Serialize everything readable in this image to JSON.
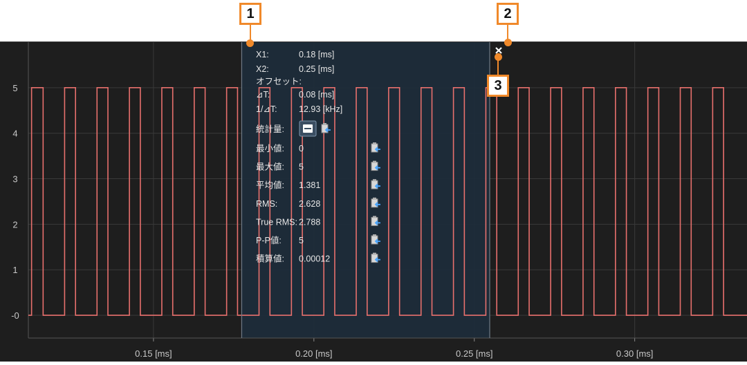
{
  "chart_data": {
    "type": "line",
    "xlabel": "",
    "ylabel": "",
    "xlim": [
      0.111,
      0.335
    ],
    "ylim": [
      -0.5,
      6.0
    ],
    "x_ticks": [
      {
        "value": 0.15,
        "label": "0.15 [ms]"
      },
      {
        "value": 0.2,
        "label": "0.20 [ms]"
      },
      {
        "value": 0.25,
        "label": "0.25 [ms]"
      },
      {
        "value": 0.3,
        "label": "0.30 [ms]"
      }
    ],
    "y_ticks": [
      {
        "value": 0,
        "label": "-0"
      },
      {
        "value": 1,
        "label": "1"
      },
      {
        "value": 2,
        "label": "2"
      },
      {
        "value": 3,
        "label": "3"
      },
      {
        "value": 4,
        "label": "4"
      },
      {
        "value": 5,
        "label": "5"
      }
    ],
    "grid": true,
    "series": [
      {
        "color": "#e8706d",
        "low": 0,
        "high": 5,
        "pulses": [
          [
            0.112,
            0.1156
          ],
          [
            0.1223,
            0.1257
          ],
          [
            0.1324,
            0.1358
          ],
          [
            0.1425,
            0.1459
          ],
          [
            0.1526,
            0.156
          ],
          [
            0.1627,
            0.1661
          ],
          [
            0.1728,
            0.1762
          ],
          [
            0.1829,
            0.1863
          ],
          [
            0.193,
            0.1964
          ],
          [
            0.2031,
            0.2065
          ],
          [
            0.2132,
            0.2166
          ],
          [
            0.2233,
            0.2267
          ],
          [
            0.2334,
            0.2368
          ],
          [
            0.2435,
            0.2469
          ],
          [
            0.2536,
            0.257
          ],
          [
            0.2637,
            0.2671
          ],
          [
            0.2738,
            0.2772
          ],
          [
            0.2839,
            0.2873
          ],
          [
            0.294,
            0.2974
          ],
          [
            0.3041,
            0.3075
          ],
          [
            0.3142,
            0.3176
          ],
          [
            0.3243,
            0.3277
          ]
        ]
      }
    ],
    "cursor_x1": 0.1775,
    "cursor_x2": 0.2548
  },
  "measure_panel": {
    "x1_label": "X1:",
    "x1_value": "0.18 [ms]",
    "x2_label": "X2:",
    "x2_value": "0.25 [ms]",
    "offset_label": "オフセット:",
    "dt_label": "⊿T:",
    "dt_value": "0.08 [ms]",
    "freq_label": "1/⊿T:",
    "freq_value": "12.93 [kHz]",
    "stats_label": "統計量:",
    "stats": [
      {
        "label": "最小値:",
        "value": "0"
      },
      {
        "label": "最大値:",
        "value": "5"
      },
      {
        "label": "平均値:",
        "value": "1.381"
      },
      {
        "label": "RMS:",
        "value": "2.628"
      },
      {
        "label": "True RMS:",
        "value": "2.788"
      },
      {
        "label": "P-P値:",
        "value": "5"
      },
      {
        "label": "積算値:",
        "value": "0.00012"
      }
    ],
    "close_glyph": "✕"
  },
  "callouts": [
    "1",
    "2",
    "3"
  ],
  "colors": {
    "background": "#1e1e1e",
    "grid": "#3a3a3a",
    "signal": "#e8706d",
    "selection": "#1d2c3a",
    "callout": "#f0892a"
  },
  "icons": {
    "copy": "copy-to-clipboard-icon",
    "collapse": "collapse-stats-icon",
    "close": "close-icon"
  }
}
